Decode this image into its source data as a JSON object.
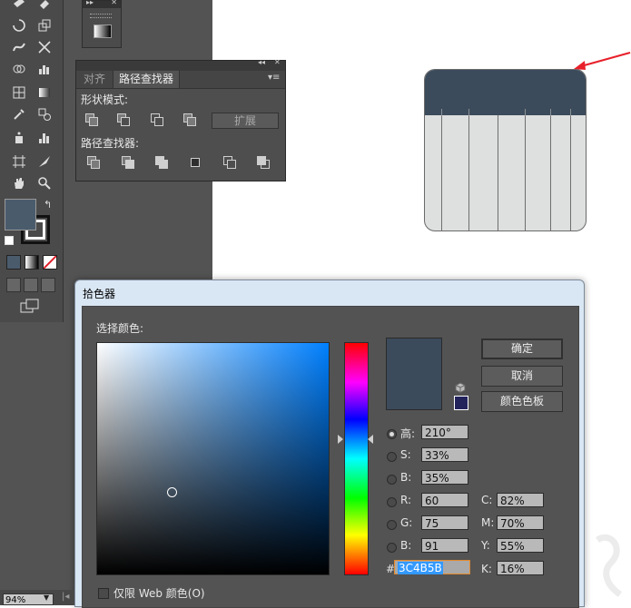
{
  "pathfinder_panel": {
    "tabs": [
      "对齐",
      "路径查找器"
    ],
    "shape_modes_label": "形状模式:",
    "expand_label": "扩展",
    "pathfinders_label": "路径查找器:"
  },
  "color_picker": {
    "title": "拾色器",
    "choose_color_label": "选择颜色:",
    "buttons": {
      "ok": "确定",
      "cancel": "取消",
      "swatches": "颜色色板"
    },
    "fields": {
      "H": {
        "label": "高:",
        "value": "210°"
      },
      "S": {
        "label": "S:",
        "value": "33%"
      },
      "Bri": {
        "label": "B:",
        "value": "35%"
      },
      "R": {
        "label": "R:",
        "value": "60"
      },
      "G": {
        "label": "G:",
        "value": "75"
      },
      "B": {
        "label": "B:",
        "value": "91"
      },
      "C": {
        "label": "C:",
        "value": "82%"
      },
      "M": {
        "label": "M:",
        "value": "70%"
      },
      "Y": {
        "label": "Y:",
        "value": "55%"
      },
      "K": {
        "label": "K:",
        "value": "16%"
      }
    },
    "hex_label": "#",
    "hex_value": "3C4B5B",
    "web_only_label": "仅限 Web 颜色(O)",
    "current_color": "#3c4b5b"
  },
  "status_bar": {
    "zoom": "94%"
  },
  "artwork": {
    "top_color": "#3c4b5b",
    "body_color": "#dedfdf"
  },
  "colors": {
    "accent_arrow": "#e8202a",
    "fill_swatch": "#4a5b6c"
  }
}
